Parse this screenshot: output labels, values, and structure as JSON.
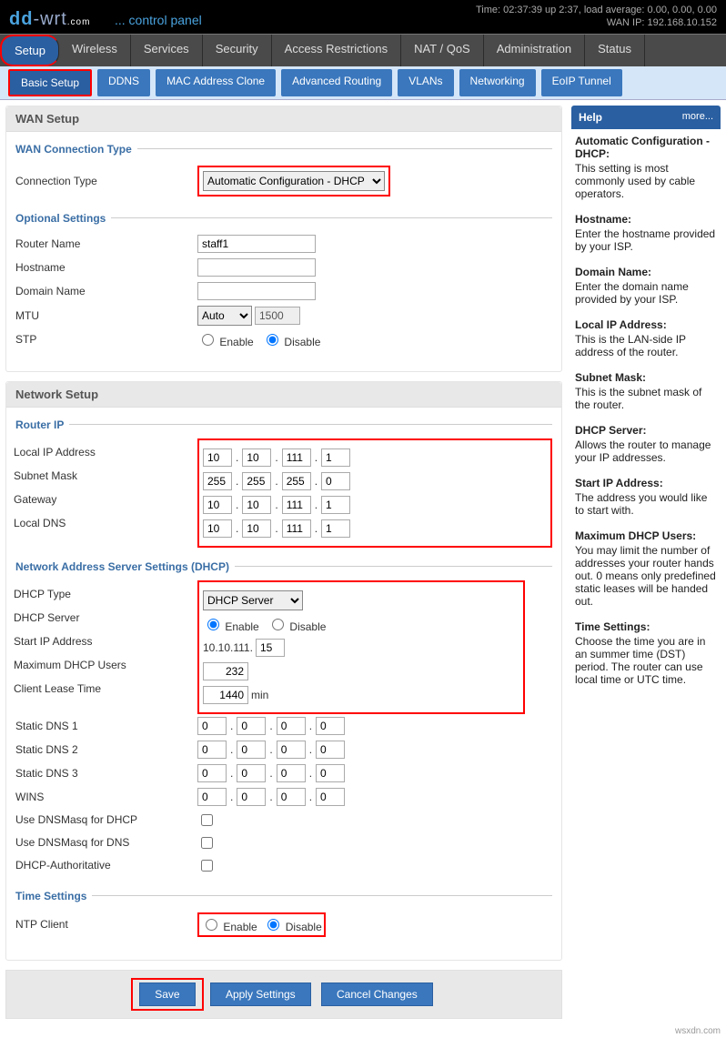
{
  "top": {
    "brand_dd": "dd",
    "brand_wrt": "-wrt",
    "brand_com": ".com",
    "cp": "... control panel",
    "time": "Time: 02:37:39 up 2:37, load average: 0.00, 0.00, 0.00",
    "wanip": "WAN IP: 192.168.10.152"
  },
  "nav1": [
    "Setup",
    "Wireless",
    "Services",
    "Security",
    "Access Restrictions",
    "NAT / QoS",
    "Administration",
    "Status"
  ],
  "nav2": [
    "Basic Setup",
    "DDNS",
    "MAC Address Clone",
    "Advanced Routing",
    "VLANs",
    "Networking",
    "EoIP Tunnel"
  ],
  "wan": {
    "title": "WAN Setup",
    "legend": "WAN Connection Type",
    "conn_label": "Connection Type",
    "conn_value": "Automatic Configuration - DHCP"
  },
  "opt": {
    "legend": "Optional Settings",
    "router_name_lbl": "Router Name",
    "router_name_val": "staff1",
    "hostname_lbl": "Hostname",
    "hostname_val": "",
    "domain_lbl": "Domain Name",
    "domain_val": "",
    "mtu_lbl": "MTU",
    "mtu_mode": "Auto",
    "mtu_val": "1500",
    "stp_lbl": "STP",
    "enable": "Enable",
    "disable": "Disable"
  },
  "net": {
    "title": "Network Setup",
    "router_ip_legend": "Router IP",
    "local_ip_lbl": "Local IP Address",
    "local_ip": [
      "10",
      "10",
      "111",
      "1"
    ],
    "subnet_lbl": "Subnet Mask",
    "subnet": [
      "255",
      "255",
      "255",
      "0"
    ],
    "gateway_lbl": "Gateway",
    "gateway": [
      "10",
      "10",
      "111",
      "1"
    ],
    "localdns_lbl": "Local DNS",
    "localdns": [
      "10",
      "10",
      "111",
      "1"
    ]
  },
  "dhcp": {
    "legend": "Network Address Server Settings (DHCP)",
    "type_lbl": "DHCP Type",
    "type_val": "DHCP Server",
    "server_lbl": "DHCP Server",
    "start_lbl": "Start IP Address",
    "start_prefix": "10.10.111.",
    "start_last": "15",
    "max_lbl": "Maximum DHCP Users",
    "max_val": "232",
    "lease_lbl": "Client Lease Time",
    "lease_val": "1440",
    "lease_unit": "min",
    "sdns1_lbl": "Static DNS 1",
    "sdns": [
      "0",
      "0",
      "0",
      "0"
    ],
    "sdns2_lbl": "Static DNS 2",
    "sdns3_lbl": "Static DNS 3",
    "wins_lbl": "WINS",
    "dnsmasq_dhcp_lbl": "Use DNSMasq for DHCP",
    "dnsmasq_dns_lbl": "Use DNSMasq for DNS",
    "auth_lbl": "DHCP-Authoritative"
  },
  "time": {
    "legend": "Time Settings",
    "ntp_lbl": "NTP Client"
  },
  "buttons": {
    "save": "Save",
    "apply": "Apply Settings",
    "cancel": "Cancel Changes"
  },
  "help": {
    "title": "Help",
    "more": "more...",
    "items": [
      {
        "h": "Automatic Configuration - DHCP:",
        "t": "This setting is most commonly used by cable operators."
      },
      {
        "h": "Hostname:",
        "t": "Enter the hostname provided by your ISP."
      },
      {
        "h": "Domain Name:",
        "t": "Enter the domain name provided by your ISP."
      },
      {
        "h": "Local IP Address:",
        "t": "This is the LAN-side IP address of the router."
      },
      {
        "h": "Subnet Mask:",
        "t": "This is the subnet mask of the router."
      },
      {
        "h": "DHCP Server:",
        "t": "Allows the router to manage your IP addresses."
      },
      {
        "h": "Start IP Address:",
        "t": "The address you would like to start with."
      },
      {
        "h": "Maximum DHCP Users:",
        "t": "You may limit the number of addresses your router hands out. 0 means only predefined static leases will be handed out."
      },
      {
        "h": "Time Settings:",
        "t": "Choose the time you are in an summer time (DST) period. The router can use local time or UTC time."
      }
    ]
  },
  "footer": "wsxdn.com"
}
